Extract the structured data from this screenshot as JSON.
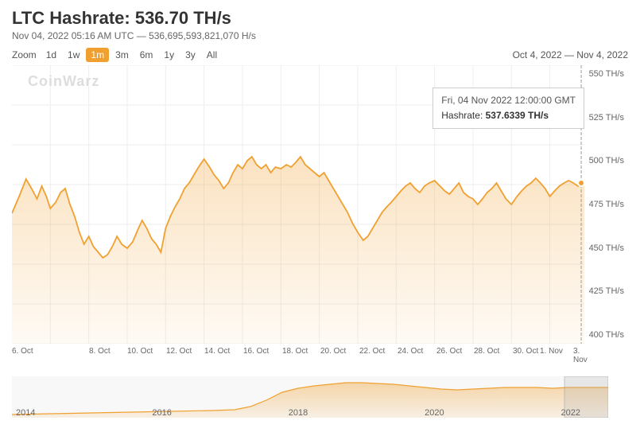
{
  "header": {
    "title": "LTC Hashrate: 536.70 TH/s",
    "subtitle": "Nov 04, 2022 05:16 AM UTC — 536,695,593,821,070 H/s"
  },
  "zoom": {
    "label": "Zoom",
    "buttons": [
      "1d",
      "1w",
      "1m",
      "3m",
      "6m",
      "1y",
      "3y",
      "All"
    ],
    "active": "1m"
  },
  "date_range": "Oct 4, 2022 — Nov 4, 2022",
  "tooltip": {
    "date": "Fri, 04 Nov 2022 12:00:00 GMT",
    "label": "Hashrate:",
    "value": "537.6339 TH/s"
  },
  "y_axis": {
    "labels": [
      "550 TH/s",
      "525 TH/s",
      "500 TH/s",
      "475 TH/s",
      "450 TH/s",
      "425 TH/s",
      "400 TH/s"
    ]
  },
  "x_axis": {
    "labels": [
      "6. Oct",
      "8. Oct",
      "10. Oct",
      "12. Oct",
      "14. Oct",
      "16. Oct",
      "18. Oct",
      "20. Oct",
      "22. Oct",
      "24. Oct",
      "26. Oct",
      "28. Oct",
      "30. Oct",
      "1. Nov",
      "3. Nov"
    ]
  },
  "mini_chart": {
    "year_labels": [
      "2014",
      "2016",
      "2018",
      "2020",
      "2022"
    ]
  },
  "watermark": "CoinWarz",
  "colors": {
    "line": "#f0a030",
    "area_fill": "#fdf0e0",
    "grid": "#eeeeee",
    "active_btn": "#f0a030"
  }
}
